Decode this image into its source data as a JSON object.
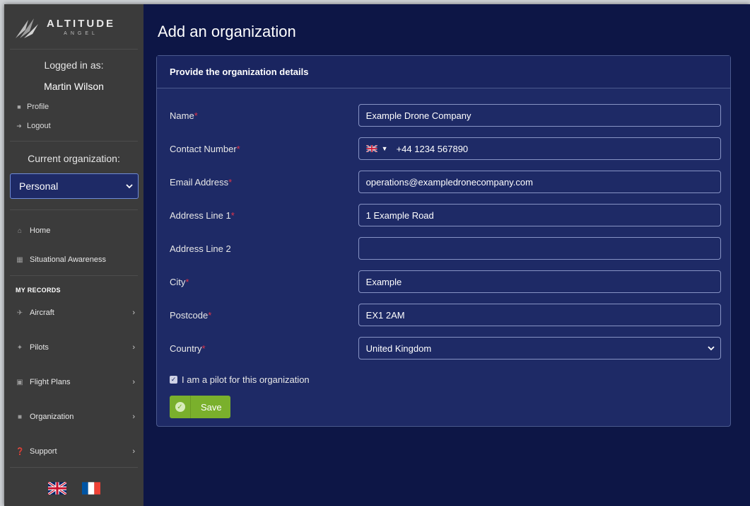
{
  "brand": {
    "name": "ALTITUDE",
    "sub": "ANGEL"
  },
  "user": {
    "logged_in_label": "Logged in as:",
    "name": "Martin Wilson",
    "profile": "Profile",
    "logout": "Logout"
  },
  "org": {
    "label": "Current organization:",
    "selected": "Personal"
  },
  "nav": {
    "home": "Home",
    "situational": "Situational Awareness",
    "records_heading": "MY RECORDS",
    "aircraft": "Aircraft",
    "pilots": "Pilots",
    "flight_plans": "Flight Plans",
    "organization": "Organization",
    "support": "Support"
  },
  "page": {
    "title": "Add an organization"
  },
  "form": {
    "header": "Provide the organization details",
    "name_label": "Name",
    "name_value": "Example Drone Company",
    "contact_label": "Contact Number",
    "contact_value": "+44 1234 567890",
    "email_label": "Email Address",
    "email_value": "operations@exampledronecompany.com",
    "addr1_label": "Address Line 1",
    "addr1_value": "1 Example Road",
    "addr2_label": "Address Line 2",
    "addr2_value": "",
    "city_label": "City",
    "city_value": "Example",
    "postcode_label": "Postcode",
    "postcode_value": "EX1 2AM",
    "country_label": "Country",
    "country_value": "United Kingdom",
    "required_mark": "*",
    "pilot_checkbox_label": "I am a pilot for this organization",
    "pilot_checked": true,
    "save_label": "Save"
  },
  "colors": {
    "sidebar": "#3b3b3b",
    "main_bg": "#0d1646",
    "card": "#1e2a66",
    "save": "#7ab02c",
    "required": "#e0344a"
  }
}
